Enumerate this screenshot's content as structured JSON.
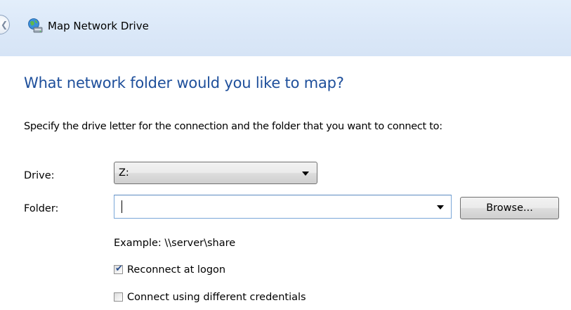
{
  "window": {
    "title": "Map Network Drive",
    "app_icon": "network-drive-icon",
    "back_icon": "back-arrow-icon"
  },
  "main": {
    "heading": "What network folder would you like to map?",
    "instruction": "Specify the drive letter for the connection and the folder that you want to connect to:",
    "drive": {
      "label": "Drive:",
      "selected_value": "Z:"
    },
    "folder": {
      "label": "Folder:",
      "value": "",
      "browse_label": "Browse..."
    },
    "example": "Example: \\\\server\\share",
    "reconnect": {
      "label": "Reconnect at logon",
      "checked": true
    },
    "credentials": {
      "label": "Connect using different credentials",
      "checked": false
    }
  },
  "colors": {
    "heading": "#1e4f9b",
    "titlebar": "#dbe8f8",
    "accent_border": "#7aa7d8"
  }
}
